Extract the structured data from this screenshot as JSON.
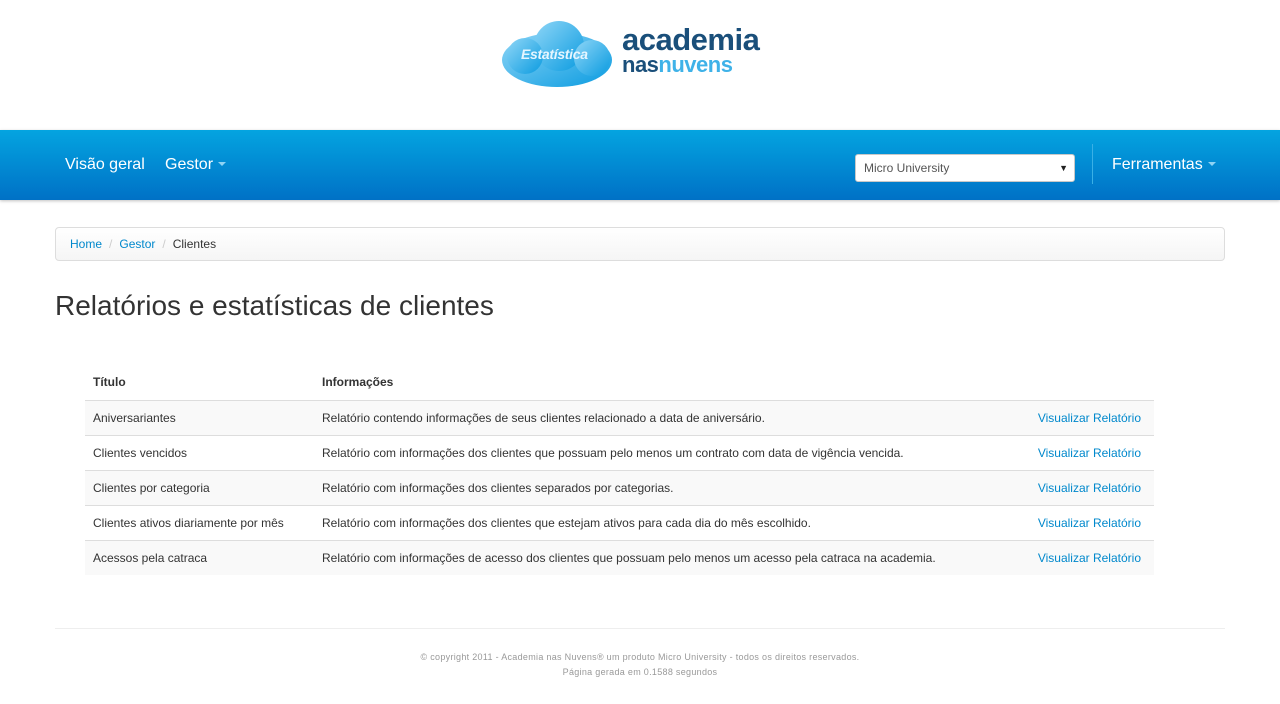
{
  "logo": {
    "cloud_text": "Estatística",
    "word1": "academia",
    "word2a": "nas",
    "word2b": "nuvens"
  },
  "nav": {
    "overview": "Visão geral",
    "manager": "Gestor",
    "unit_select": "Micro University",
    "tools": "Ferramentas"
  },
  "breadcrumb": {
    "home": "Home",
    "manager": "Gestor",
    "current": "Clientes"
  },
  "page": {
    "title": "Relatórios e estatísticas de clientes"
  },
  "table": {
    "headers": [
      "Título",
      "Informações",
      ""
    ],
    "rows": [
      {
        "title": "Aniversariantes",
        "info": "Relatório contendo informações de seus clientes relacionado a data de aniversário.",
        "link": "Visualizar Relatório"
      },
      {
        "title": "Clientes vencidos",
        "info": "Relatório com informações dos clientes que possuam pelo menos um contrato com data de vigência vencida.",
        "link": "Visualizar Relatório"
      },
      {
        "title": "Clientes por categoria",
        "info": "Relatório com informações dos clientes separados por categorias.",
        "link": "Visualizar Relatório"
      },
      {
        "title": "Clientes ativos diariamente por mês",
        "info": "Relatório com informações dos clientes que estejam ativos para cada dia do mês escolhido.",
        "link": "Visualizar Relatório"
      },
      {
        "title": "Acessos pela catraca",
        "info": "Relatório com informações de acesso dos clientes que possuam pelo menos um acesso pela catraca na academia.",
        "link": "Visualizar Relatório"
      }
    ]
  },
  "footer": {
    "copyright": "© copyright 2011 - Academia nas Nuvens® um produto Micro University - todos os direitos reservados.",
    "generated": "Página gerada em 0.1588 segundos"
  },
  "colors": {
    "navbar_top": "#04a4e0",
    "navbar_bottom": "#0071c6",
    "link": "#0088cc",
    "logo_dark": "#1a4f7a",
    "logo_light": "#3fb2e8"
  }
}
